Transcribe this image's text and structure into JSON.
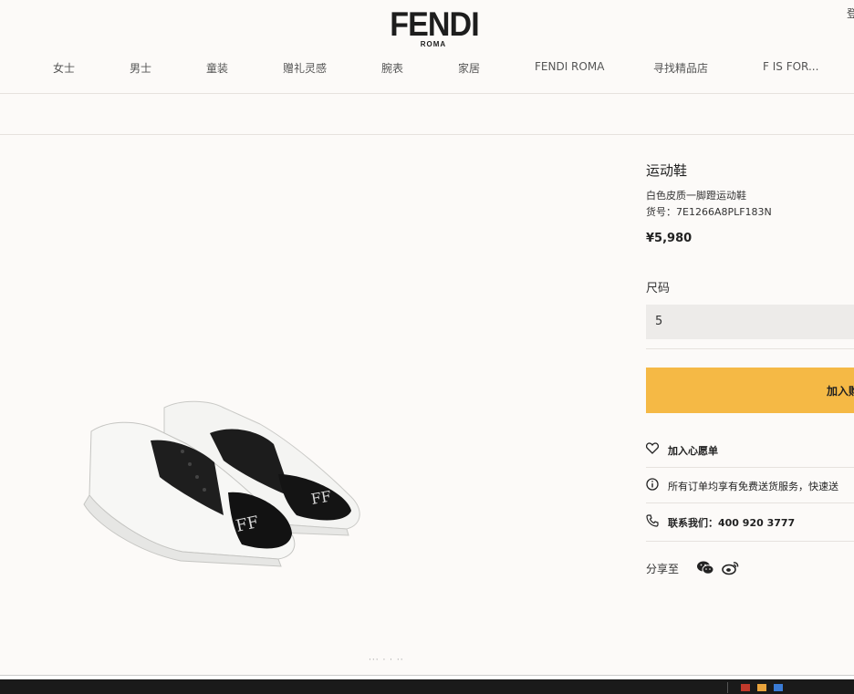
{
  "header": {
    "logo": "FENDI",
    "logo_sub": "ROMA",
    "login": "登",
    "nav": [
      "女士",
      "男士",
      "童装",
      "赠礼灵感",
      "腕表",
      "家居",
      "FENDI ROMA",
      "寻找精品店",
      "F IS FOR..."
    ]
  },
  "product": {
    "title": "运动鞋",
    "subtitle": "白色皮质一脚蹬运动鞋",
    "sku": "货号：7E1266A8PLF183N",
    "price": "¥5,980",
    "size_label": "尺码",
    "size_value": "5",
    "add_to_cart": "加入购",
    "wishlist": "加入心愿单",
    "shipping": "所有订单均享有免费送货服务，快速送",
    "contact": "联系我们：400 920 3777",
    "share_label": "分享至"
  },
  "colors": {
    "accent": "#f5b945",
    "background": "#fcfaf8"
  },
  "icons": [
    "heart-icon",
    "info-icon",
    "phone-icon",
    "wechat-icon",
    "weibo-icon"
  ]
}
